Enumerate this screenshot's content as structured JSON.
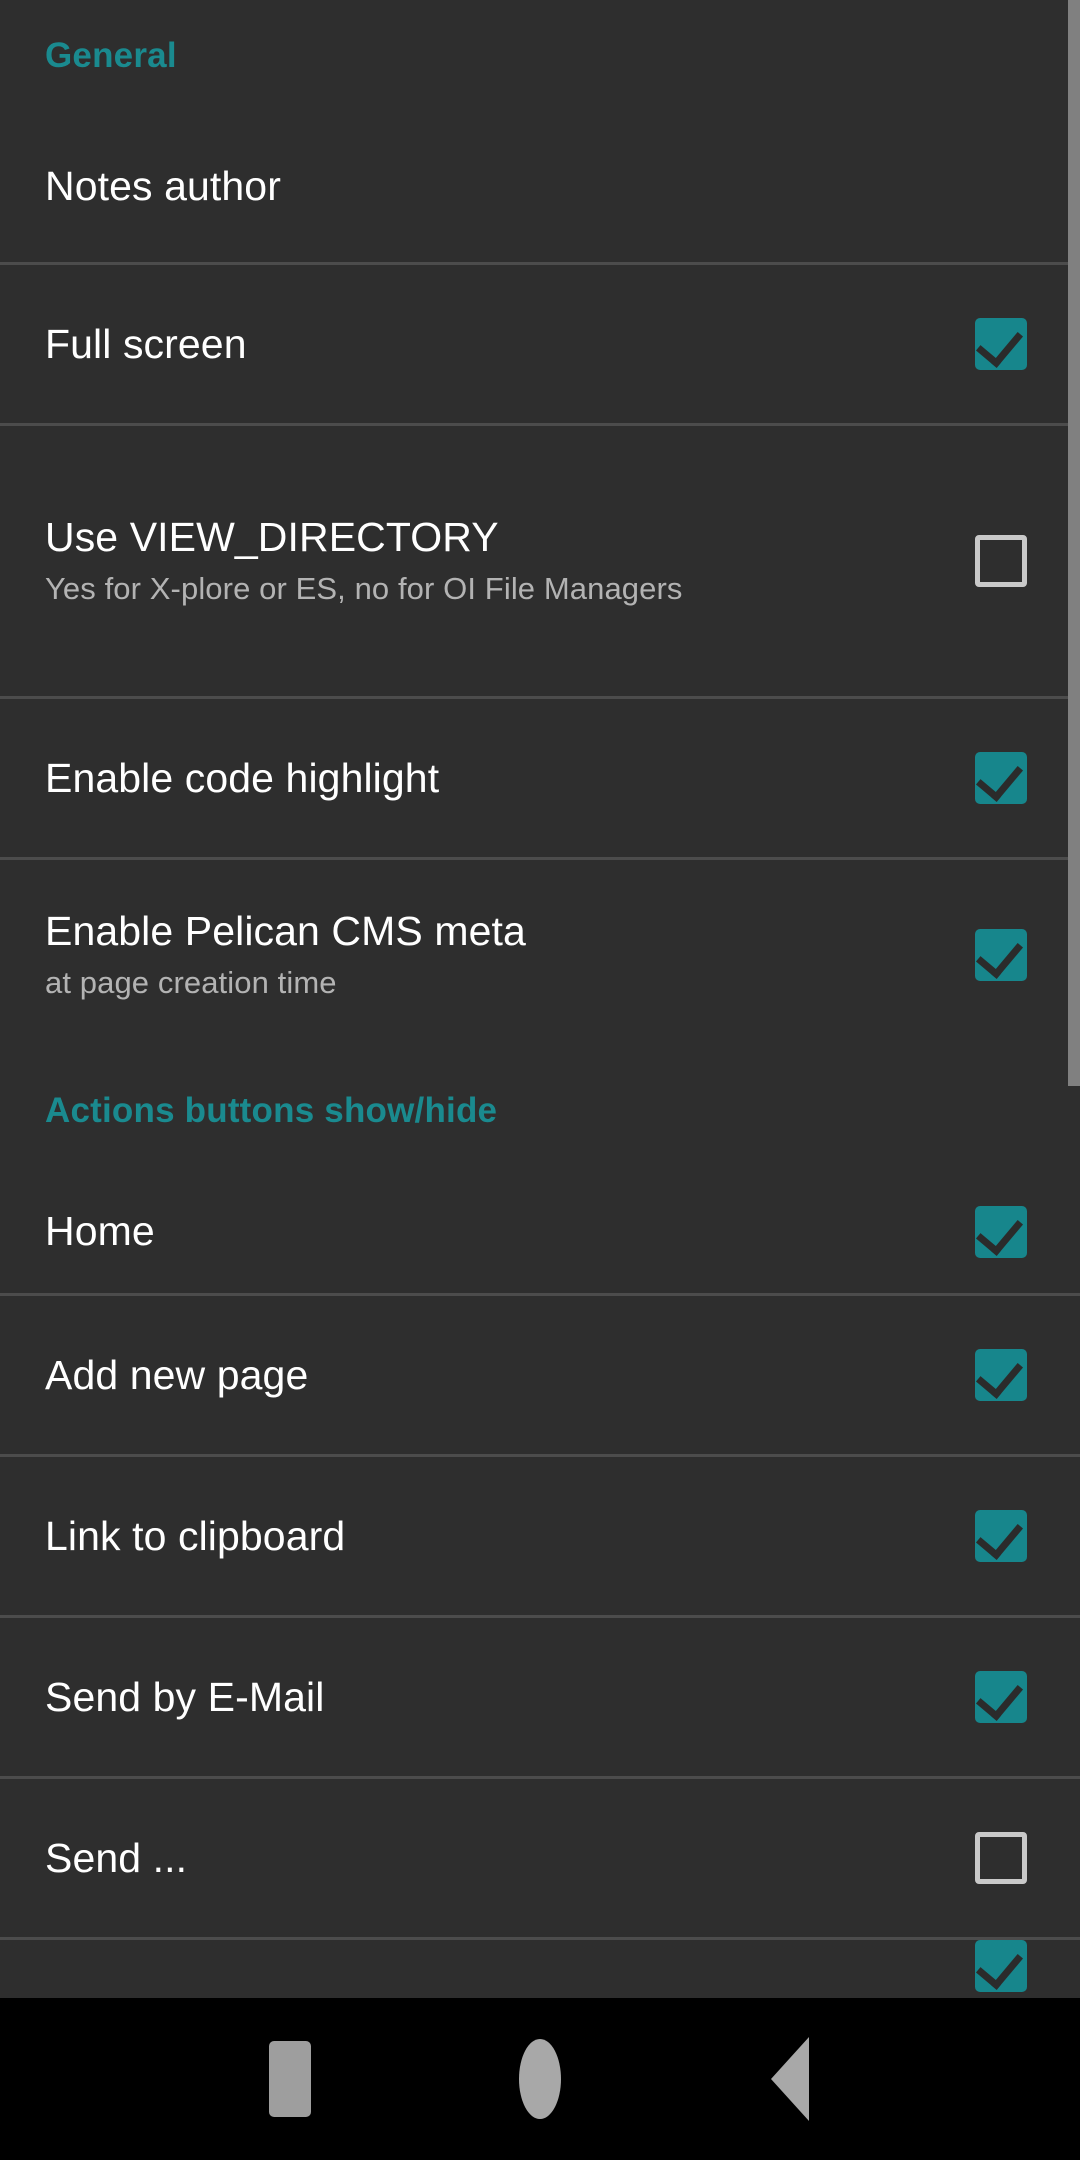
{
  "theme": {
    "background": "#2e2e2e",
    "accent": "#17868c",
    "header_accent": "#1a8a8f",
    "primary_text": "#ffffff",
    "secondary_text": "#b3b3b3",
    "divider": "#4c4c4c",
    "navbar_background": "#000000",
    "scrollbar": "#808080"
  },
  "sections": [
    {
      "header": "General",
      "rows": [
        {
          "title": "Notes author",
          "summary": "",
          "has_checkbox": false,
          "checked": false
        },
        {
          "title": "Full screen",
          "summary": "",
          "has_checkbox": true,
          "checked": true
        },
        {
          "title": "Use VIEW_DIRECTORY",
          "summary": "Yes for X-plore or ES, no for OI File Managers",
          "has_checkbox": true,
          "checked": false
        },
        {
          "title": "Enable code highlight",
          "summary": "",
          "has_checkbox": true,
          "checked": true
        },
        {
          "title": "Enable Pelican CMS meta",
          "summary": "at page creation time",
          "has_checkbox": true,
          "checked": true
        }
      ]
    },
    {
      "header": "Actions buttons show/hide",
      "rows": [
        {
          "title": "Home",
          "summary": "",
          "has_checkbox": true,
          "checked": true
        },
        {
          "title": "Add new page",
          "summary": "",
          "has_checkbox": true,
          "checked": true
        },
        {
          "title": "Link to clipboard",
          "summary": "",
          "has_checkbox": true,
          "checked": true
        },
        {
          "title": "Send by E-Mail",
          "summary": "",
          "has_checkbox": true,
          "checked": true
        },
        {
          "title": "Send ...",
          "summary": "",
          "has_checkbox": true,
          "checked": false
        }
      ]
    }
  ],
  "navigation_bar": {
    "recents_label": "recents",
    "home_label": "home",
    "back_label": "back"
  }
}
